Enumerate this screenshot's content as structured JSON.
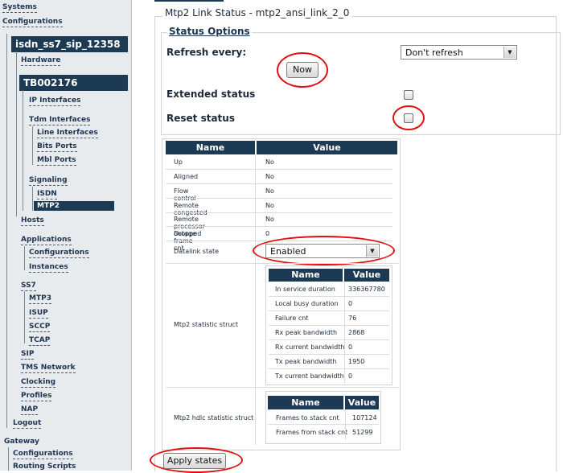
{
  "sidebar": {
    "systems": "Systems",
    "configurations": "Configurations",
    "system_name": "isdn_ss7_sip_12358",
    "hardware": "Hardware",
    "board": "TB002176",
    "ip_interfaces": "IP Interfaces",
    "tdm_interfaces": "Tdm Interfaces",
    "line_interfaces": "Line Interfaces",
    "bits_ports": "Bits Ports",
    "mbl_ports": "Mbl Ports",
    "signaling": "Signaling",
    "isdn": "ISDN",
    "mtp2": "MTP2",
    "hosts": "Hosts",
    "applications": "Applications",
    "app_configurations": "Configurations",
    "instances": "Instances",
    "ss7": "SS7",
    "mtp3": "MTP3",
    "isup": "ISUP",
    "sccp": "SCCP",
    "tcap": "TCAP",
    "sip": "SIP",
    "tms_network": "TMS Network",
    "clocking": "Clocking",
    "profiles": "Profiles",
    "nap": "NAP",
    "logout": "Logout",
    "gateway": "Gateway",
    "gw_configurations": "Configurations",
    "routing_scripts": "Routing Scripts"
  },
  "main": {
    "title": "Mtp2 Link Status - mtp2_ansi_link_2_0",
    "status_options": "Status Options",
    "refresh_every": "Refresh every:",
    "refresh_value": "Don't refresh",
    "now_button": "Now",
    "extended_status": "Extended status",
    "reset_status": "Reset status",
    "apply_button": "Apply states"
  },
  "status_table": {
    "headers": [
      "Name",
      "Value"
    ],
    "rows": [
      {
        "name": "Up",
        "value": "No"
      },
      {
        "name": "Aligned",
        "value": "No"
      },
      {
        "name": "Flow control",
        "value": "No"
      },
      {
        "name": "Remote congested",
        "value": "No"
      },
      {
        "name": "Remote processor outage",
        "value": "No"
      },
      {
        "name": "Dropped frame cnt",
        "value": "0"
      }
    ],
    "datalink_label": "Datalink state",
    "datalink_value": "Enabled",
    "stat_struct_label": "Mtp2 statistic struct",
    "stat_struct": {
      "headers": [
        "Name",
        "Value"
      ],
      "rows": [
        {
          "name": "In service duration",
          "value": "336367780"
        },
        {
          "name": "Local busy duration",
          "value": "0"
        },
        {
          "name": "Failure cnt",
          "value": "76"
        },
        {
          "name": "Rx peak bandwidth",
          "value": "2868"
        },
        {
          "name": "Rx current bandwidth",
          "value": "0"
        },
        {
          "name": "Tx peak bandwidth",
          "value": "1950"
        },
        {
          "name": "Tx current bandwidth",
          "value": "0"
        }
      ]
    },
    "hdlc_struct_label": "Mtp2 hdlc statistic struct",
    "hdlc_struct": {
      "headers": [
        "Name",
        "Value"
      ],
      "rows": [
        {
          "name": "Frames to stack cnt",
          "value": "107124"
        },
        {
          "name": "Frames from stack cnt",
          "value": "51299"
        }
      ]
    }
  },
  "colors": {
    "header_bg": "#1d3a55",
    "annotation_ring": "#e01010"
  }
}
